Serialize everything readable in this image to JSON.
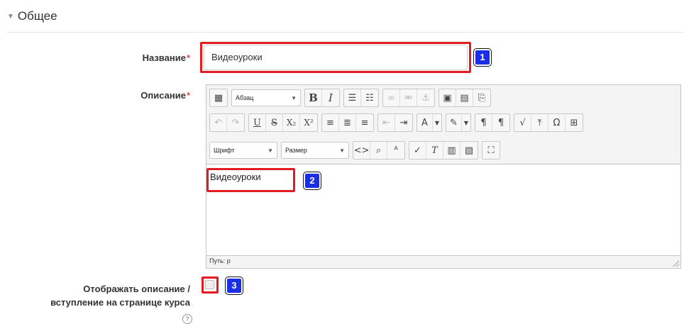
{
  "section": {
    "title": "Общее",
    "toggle_icon": "triangle-down-icon"
  },
  "form": {
    "name": {
      "label": "Название",
      "required_mark": "*",
      "value": "Видеоуроки"
    },
    "description": {
      "label": "Описание",
      "required_mark": "*"
    },
    "show_description": {
      "label_line1": "Отображать описание /",
      "label_line2": "вступление на странице курса",
      "checked": false
    }
  },
  "editor": {
    "paragraph_select": "Абзац",
    "font_select": "Шрифт",
    "size_select": "Размер",
    "content": "Видеоуроки",
    "path": "Путь: p",
    "toolbar_row1": [
      "toolbar-toggle-icon",
      "bold-icon",
      "italic-icon",
      "unordered-list-icon",
      "ordered-list-icon",
      "link-icon",
      "unlink-icon",
      "anchor-icon",
      "image-icon",
      "media-icon",
      "manage-files-icon"
    ],
    "toolbar_row2": [
      "undo-icon",
      "redo-icon",
      "underline-icon",
      "strikethrough-icon",
      "subscript-icon",
      "superscript-icon",
      "align-left-icon",
      "align-center-icon",
      "align-right-icon",
      "outdent-icon",
      "indent-icon",
      "text-color-icon",
      "background-color-icon",
      "ltr-icon",
      "rtl-icon",
      "equation-icon",
      "upload-icon",
      "special-char-icon",
      "table-icon"
    ],
    "toolbar_row3": [
      "code-icon",
      "search-replace-icon",
      "spellcheck-icon",
      "clear-formatting-icon",
      "remove-format-icon",
      "paste-text-icon",
      "paste-word-icon",
      "fullscreen-icon"
    ]
  },
  "badges": {
    "b1": "1",
    "b2": "2",
    "b3": "3"
  },
  "colors": {
    "highlight": "#e31b23",
    "badge": "#1a2ee6",
    "required": "#d9534f"
  },
  "help_icon": "?"
}
